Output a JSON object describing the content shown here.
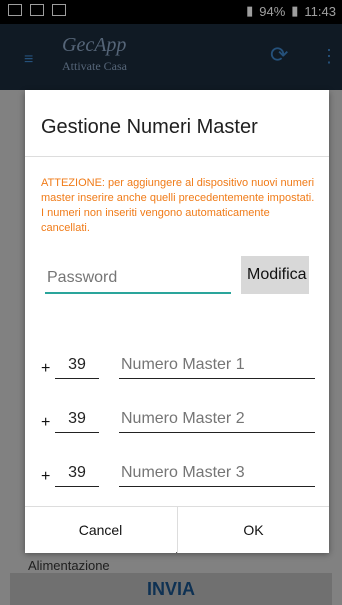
{
  "status_bar": {
    "battery_percent": "94%",
    "time": "11:43"
  },
  "app_bar": {
    "brand": "GecApp",
    "subtitle": "Attivate Casa",
    "icons": [
      "menu-icon",
      "refresh-icon",
      "more-vert-icon"
    ]
  },
  "background": {
    "labels": [
      "Alimentazione"
    ],
    "bottom_button_label": "INVIA"
  },
  "dialog": {
    "title": "Gestione Numeri Master",
    "warning": "ATTEZIONE: per aggiungere al dispositivo nuovi numeri master inserire anche quelli precedentemente impostati. I numeri non inseriti vengono automaticamente cancellati.",
    "password_placeholder": "Password",
    "modify_button": "Modifica",
    "rows": [
      {
        "plus": "+",
        "prefix": "39",
        "placeholder": "Numero Master 1"
      },
      {
        "plus": "+",
        "prefix": "39",
        "placeholder": "Numero Master 2"
      },
      {
        "plus": "+",
        "prefix": "39",
        "placeholder": "Numero Master 3"
      }
    ],
    "cancel": "Cancel",
    "ok": "OK"
  },
  "colors": {
    "appbar": "#1b2a3a",
    "accent_blue": "#3c84c7",
    "warning_orange": "#f07b18",
    "teal_focus": "#2aa59b"
  }
}
